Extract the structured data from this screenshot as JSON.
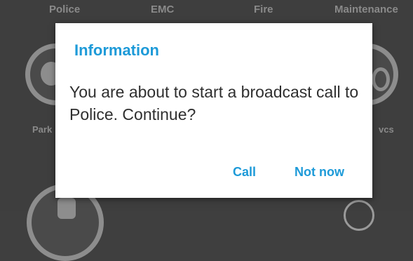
{
  "background": {
    "tiles": [
      {
        "label": "Police"
      },
      {
        "label": "EMC"
      },
      {
        "label": "Fire"
      },
      {
        "label": "Maintenance"
      },
      {
        "label": "Park"
      },
      {
        "label": "vcs"
      }
    ]
  },
  "dialog": {
    "title": "Information",
    "message": "You are about to start a broadcast call to Police. Continue?",
    "call_label": "Call",
    "not_now_label": "Not now"
  },
  "colors": {
    "accent": "#1d9ad8",
    "background": "#3e3e3e",
    "dialog": "#ffffff",
    "text": "#2f2f2f"
  }
}
